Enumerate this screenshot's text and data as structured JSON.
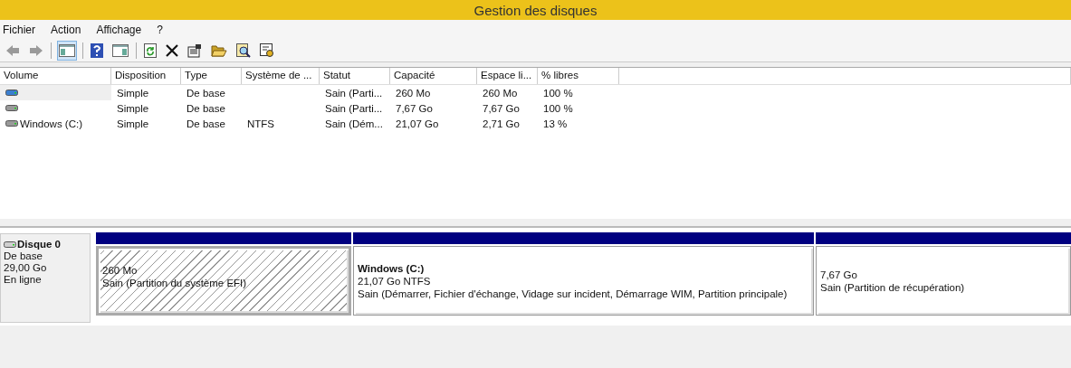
{
  "window": {
    "title": "Gestion des disques"
  },
  "menu": [
    "Fichier",
    "Action",
    "Affichage",
    "?"
  ],
  "toolbar": [
    {
      "kind": "back",
      "disabled": true
    },
    {
      "kind": "forward",
      "disabled": true
    },
    {
      "kind": "sep"
    },
    {
      "kind": "tree",
      "selected": true
    },
    {
      "kind": "sep"
    },
    {
      "kind": "help"
    },
    {
      "kind": "pane"
    },
    {
      "kind": "sep"
    },
    {
      "kind": "refresh"
    },
    {
      "kind": "delete"
    },
    {
      "kind": "properties"
    },
    {
      "kind": "open"
    },
    {
      "kind": "search"
    },
    {
      "kind": "settings"
    }
  ],
  "table": {
    "columns": [
      "Volume",
      "Disposition",
      "Type",
      "Système de ...",
      "Statut",
      "Capacité",
      "Espace li...",
      "% libres"
    ],
    "rows": [
      {
        "color": "#3a7fd0",
        "selected": true,
        "cells": [
          null,
          "Simple",
          "De base",
          null,
          "Sain (Parti...",
          "260 Mo",
          "260 Mo",
          "100 %"
        ]
      },
      {
        "color": "#9a9a9a",
        "selected": false,
        "cells": [
          null,
          "Simple",
          "De base",
          null,
          "Sain (Parti...",
          "7,67 Go",
          "7,67 Go",
          "100 %"
        ]
      },
      {
        "color": "#9a9a9a",
        "selected": false,
        "cells": [
          "Windows (C:)",
          "Simple",
          "De base",
          "NTFS",
          "Sain (Dém...",
          "21,07 Go",
          "2,71 Go",
          "13 %"
        ]
      }
    ]
  },
  "disk": {
    "name": "Disque 0",
    "type": "De base",
    "size": "29,00 Go",
    "status": "En ligne",
    "partitions": [
      {
        "selected": true,
        "size": "260 Mo",
        "status": "Sain (Partition du système EFI)"
      },
      {
        "selected": false,
        "title": "Windows  (C:)",
        "size": "21,07 Go NTFS",
        "status": "Sain (Démarrer, Fichier d'échange, Vidage sur incident, Démarrage WIM, Partition principale)"
      },
      {
        "selected": false,
        "size": "7,67 Go",
        "status": "Sain (Partition de récupération)"
      }
    ]
  }
}
